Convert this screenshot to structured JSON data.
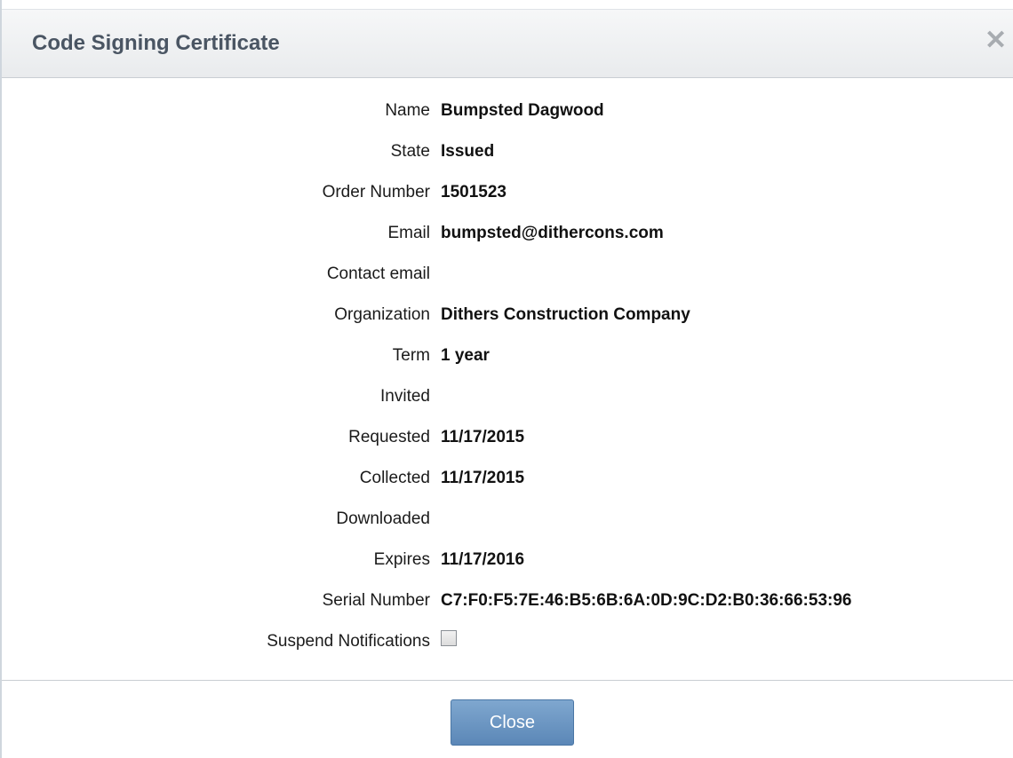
{
  "dialog": {
    "title": "Code Signing Certificate",
    "close_icon": "close-icon",
    "close_glyph": "✕"
  },
  "fields": {
    "name": {
      "label": "Name",
      "value": "Bumpsted Dagwood"
    },
    "state": {
      "label": "State",
      "value": "Issued"
    },
    "order_number": {
      "label": "Order Number",
      "value": "1501523"
    },
    "email": {
      "label": "Email",
      "value": "bumpsted@dithercons.com"
    },
    "contact_email": {
      "label": "Contact email",
      "value": ""
    },
    "organization": {
      "label": "Organization",
      "value": "Dithers Construction Company"
    },
    "term": {
      "label": "Term",
      "value": "1 year"
    },
    "invited": {
      "label": "Invited",
      "value": ""
    },
    "requested": {
      "label": "Requested",
      "value": "11/17/2015"
    },
    "collected": {
      "label": "Collected",
      "value": "11/17/2015"
    },
    "downloaded": {
      "label": "Downloaded",
      "value": ""
    },
    "expires": {
      "label": "Expires",
      "value": "11/17/2016"
    },
    "serial_number": {
      "label": "Serial Number",
      "value": "C7:F0:F5:7E:46:B5:6B:6A:0D:9C:D2:B0:36:66:53:96"
    },
    "suspend_notifications": {
      "label": "Suspend Notifications",
      "checked": false
    }
  },
  "footer": {
    "close_label": "Close"
  }
}
